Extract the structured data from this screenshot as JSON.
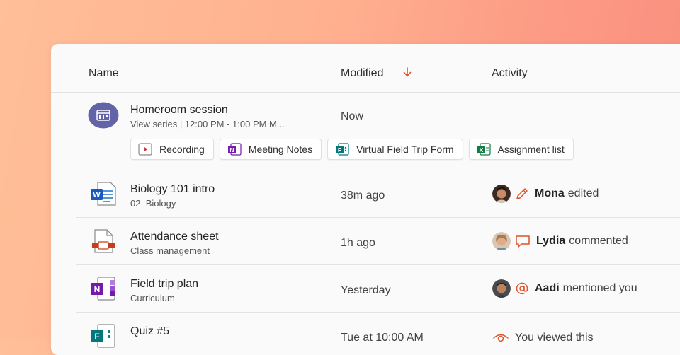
{
  "columns": {
    "name": "Name",
    "modified": "Modified",
    "activity": "Activity"
  },
  "accent_color": "#e0532a",
  "meeting": {
    "title": "Homeroom session",
    "subtitle": "View series | 12:00 PM - 1:00 PM  M...",
    "modified": "Now",
    "attachments": [
      {
        "label": "Recording",
        "icon": "video-recording-icon"
      },
      {
        "label": "Meeting Notes",
        "icon": "onenote-icon"
      },
      {
        "label": "Virtual Field Trip Form",
        "icon": "forms-icon"
      },
      {
        "label": "Assignment list",
        "icon": "excel-icon"
      }
    ]
  },
  "files": [
    {
      "title": "Biology 101 intro",
      "subtitle": "02–Biology",
      "modified": "38m ago",
      "icon": "word-doc-icon",
      "activity": {
        "user": "Mona",
        "action": "edited",
        "icon": "pencil-icon"
      }
    },
    {
      "title": "Attendance sheet",
      "subtitle": "Class management",
      "modified": "1h ago",
      "icon": "powerpoint-file-icon",
      "activity": {
        "user": "Lydia",
        "action": "commented",
        "icon": "comment-icon"
      }
    },
    {
      "title": "Field trip plan",
      "subtitle": "Curriculum",
      "modified": "Yesterday",
      "icon": "onenote-file-icon",
      "activity": {
        "user": "Aadi",
        "action": "mentioned you",
        "icon": "at-mention-icon"
      }
    },
    {
      "title": "Quiz #5",
      "subtitle": "",
      "modified": "Tue at 10:00 AM",
      "icon": "forms-file-icon",
      "activity": {
        "user": "",
        "action": "You viewed this",
        "icon": "eye-icon"
      }
    }
  ]
}
